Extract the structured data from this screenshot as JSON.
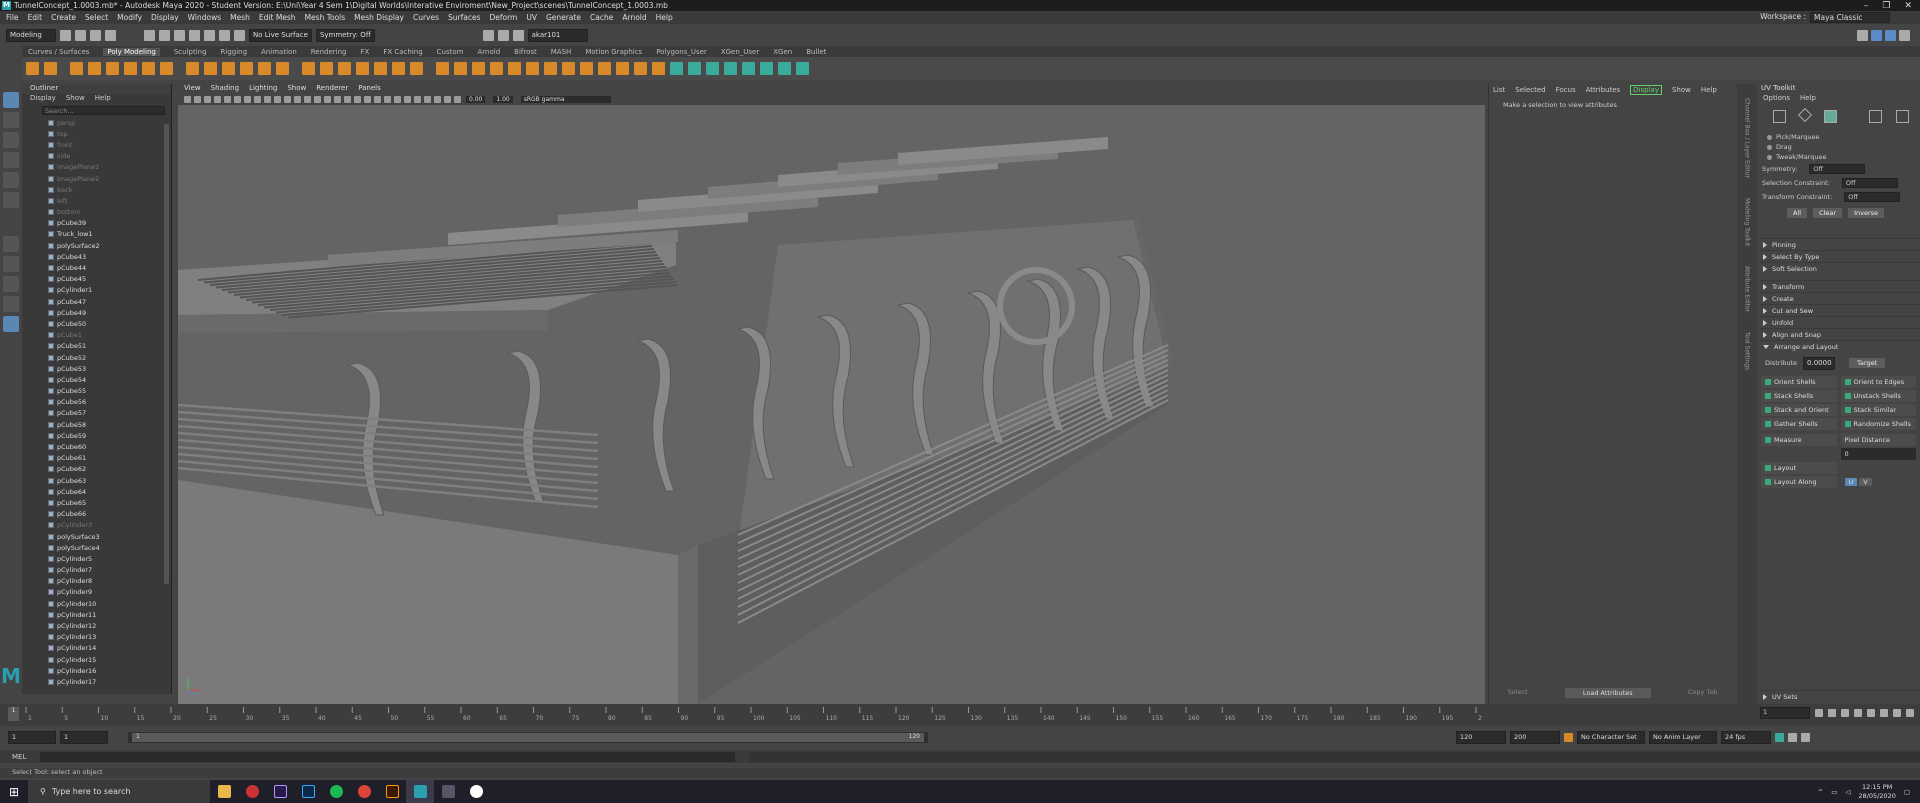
{
  "window": {
    "title": "TunnelConcept_1.0003.mb* - Autodesk Maya 2020 - Student Version: E:\\Uni\\Year 4 Sem 1\\Digital Worlds\\Interative Enviroment\\New_Project\\scenes\\TunnelConcept_1.0003.mb",
    "logo_letter": "M"
  },
  "menubar": {
    "items": [
      "File",
      "Edit",
      "Create",
      "Select",
      "Modify",
      "Display",
      "Windows",
      "Mesh",
      "Edit Mesh",
      "Mesh Tools",
      "Mesh Display",
      "Curves",
      "Surfaces",
      "Deform",
      "UV",
      "Generate",
      "Cache",
      "Arnold",
      "Help"
    ],
    "workspace_label": "Workspace :",
    "workspace_value": "Maya Classic"
  },
  "statusline": {
    "mode": "Modeling",
    "live": "No Live Surface",
    "symmetry": "Symmetry: Off",
    "user": "akar101"
  },
  "shelf": {
    "tabs": [
      "Curves / Surfaces",
      "Poly Modeling",
      "Sculpting",
      "Rigging",
      "Animation",
      "Rendering",
      "FX",
      "FX Caching",
      "Custom",
      "Arnold",
      "Bifrost",
      "MASH",
      "Motion Graphics",
      "Polygons_User",
      "XGen_User",
      "XGen",
      "Bullet"
    ],
    "active_index": 1
  },
  "outliner": {
    "title": "Outliner",
    "menus": [
      "Display",
      "Show",
      "Help"
    ],
    "search_placeholder": "Search...",
    "items": [
      {
        "label": "persp",
        "dim": true
      },
      {
        "label": "top",
        "dim": true
      },
      {
        "label": "front",
        "dim": true
      },
      {
        "label": "side",
        "dim": true
      },
      {
        "label": "imagePlane1",
        "dim": true
      },
      {
        "label": "imagePlane2",
        "dim": true
      },
      {
        "label": "back",
        "dim": true
      },
      {
        "label": "left",
        "dim": true
      },
      {
        "label": "bottom",
        "dim": true
      },
      {
        "label": "pCube39",
        "dim": false
      },
      {
        "label": "Truck_low1",
        "dim": false
      },
      {
        "label": "polySurface2",
        "dim": false
      },
      {
        "label": "pCube43",
        "dim": false
      },
      {
        "label": "pCube44",
        "dim": false
      },
      {
        "label": "pCube45",
        "dim": false
      },
      {
        "label": "pCylinder1",
        "dim": false
      },
      {
        "label": "pCube47",
        "dim": false
      },
      {
        "label": "pCube49",
        "dim": false
      },
      {
        "label": "pCube50",
        "dim": false
      },
      {
        "label": "pCube1",
        "dim": true
      },
      {
        "label": "pCube51",
        "dim": false
      },
      {
        "label": "pCube52",
        "dim": false
      },
      {
        "label": "pCube53",
        "dim": false
      },
      {
        "label": "pCube54",
        "dim": false
      },
      {
        "label": "pCube55",
        "dim": false
      },
      {
        "label": "pCube56",
        "dim": false
      },
      {
        "label": "pCube57",
        "dim": false
      },
      {
        "label": "pCube58",
        "dim": false
      },
      {
        "label": "pCube59",
        "dim": false
      },
      {
        "label": "pCube60",
        "dim": false
      },
      {
        "label": "pCube61",
        "dim": false
      },
      {
        "label": "pCube62",
        "dim": false
      },
      {
        "label": "pCube63",
        "dim": false
      },
      {
        "label": "pCube64",
        "dim": false
      },
      {
        "label": "pCube65",
        "dim": false
      },
      {
        "label": "pCube66",
        "dim": false
      },
      {
        "label": "pCylinder3",
        "dim": true
      },
      {
        "label": "polySurface3",
        "dim": false
      },
      {
        "label": "polySurface4",
        "dim": false
      },
      {
        "label": "pCylinder5",
        "dim": false
      },
      {
        "label": "pCylinder7",
        "dim": false
      },
      {
        "label": "pCylinder8",
        "dim": false
      },
      {
        "label": "pCylinder9",
        "dim": false
      },
      {
        "label": "pCylinder10",
        "dim": false
      },
      {
        "label": "pCylinder11",
        "dim": false
      },
      {
        "label": "pCylinder12",
        "dim": false
      },
      {
        "label": "pCylinder13",
        "dim": false
      },
      {
        "label": "pCylinder14",
        "dim": false
      },
      {
        "label": "pCylinder15",
        "dim": false
      },
      {
        "label": "pCylinder16",
        "dim": false
      },
      {
        "label": "pCylinder17",
        "dim": false
      }
    ]
  },
  "viewport": {
    "menus": [
      "View",
      "Shading",
      "Lighting",
      "Show",
      "Renderer",
      "Panels"
    ],
    "exposure": "0.00",
    "gamma": "1.00",
    "colorspace": "sRGB gamma"
  },
  "attribute_editor": {
    "menus": [
      "List",
      "Selected",
      "Focus",
      "Attributes",
      "Display",
      "Show",
      "Help"
    ],
    "message": "Make a selection to view attributes",
    "bottom": [
      "Select",
      "Load Attributes",
      "Copy Tab"
    ]
  },
  "side_tabs": [
    "Channel Box / Layer Editor",
    "Modeling Toolkit",
    "Attribute Editor",
    "Tool Settings"
  ],
  "uv_toolkit": {
    "title": "UV Toolkit",
    "menus": [
      "Options",
      "Help"
    ],
    "modes": [
      "Pick/Marquee",
      "Drag",
      "Tweak/Marquee"
    ],
    "symmetry_label": "Symmetry:",
    "symmetry_value": "Off",
    "sel_constraint_label": "Selection Constraint:",
    "sel_constraint_value": "Off",
    "tr_constraint_label": "Transform Constraint:",
    "tr_constraint_value": "Off",
    "buttons": [
      "All",
      "Clear",
      "Inverse"
    ],
    "sections_top": [
      "Pinning",
      "Select By Type",
      "Soft Selection"
    ],
    "sections_mid": [
      "Transform",
      "Create",
      "Cut and Sew",
      "Unfold",
      "Align and Snap",
      "Arrange and Layout"
    ],
    "distribute_label": "Distribute",
    "distribute_value": "0.0000",
    "target_label": "Target",
    "arrange": [
      "Orient Shells",
      "Orient to Edges",
      "Stack Shells",
      "Unstack Shells",
      "Stack and Orient",
      "Stack Similar",
      "Gather Shells",
      "Randomize Shells"
    ],
    "measure_label": "Measure",
    "measure_value": "Pixel Distance",
    "measure_num": "0",
    "layout_label": "Layout",
    "layout_along_label": "Layout Along",
    "u": "U",
    "v": "V",
    "uvsets_label": "UV Sets"
  },
  "timeline": {
    "ticks": [
      "1",
      "5",
      "10",
      "15",
      "20",
      "25",
      "30",
      "35",
      "40",
      "45",
      "50",
      "55",
      "60",
      "65",
      "70",
      "75",
      "80",
      "85",
      "90",
      "95",
      "100",
      "105",
      "110",
      "115",
      "120",
      "125",
      "130",
      "135",
      "140",
      "145",
      "150",
      "155",
      "160",
      "165",
      "170",
      "175",
      "180",
      "185",
      "190",
      "195",
      "200"
    ],
    "current": "1"
  },
  "range": {
    "start": "1",
    "start2": "1",
    "range_start": "1",
    "range_end": "120",
    "end": "120",
    "end2": "200",
    "charset": "No Character Set",
    "animlayer": "No Anim Layer",
    "fps": "24 fps"
  },
  "cmdline": {
    "label": "MEL"
  },
  "helpline": {
    "text": "Select Tool: select an object"
  },
  "taskbar": {
    "search_placeholder": "Type here to search",
    "time": "12:15 PM",
    "date": "28/05/2020"
  }
}
